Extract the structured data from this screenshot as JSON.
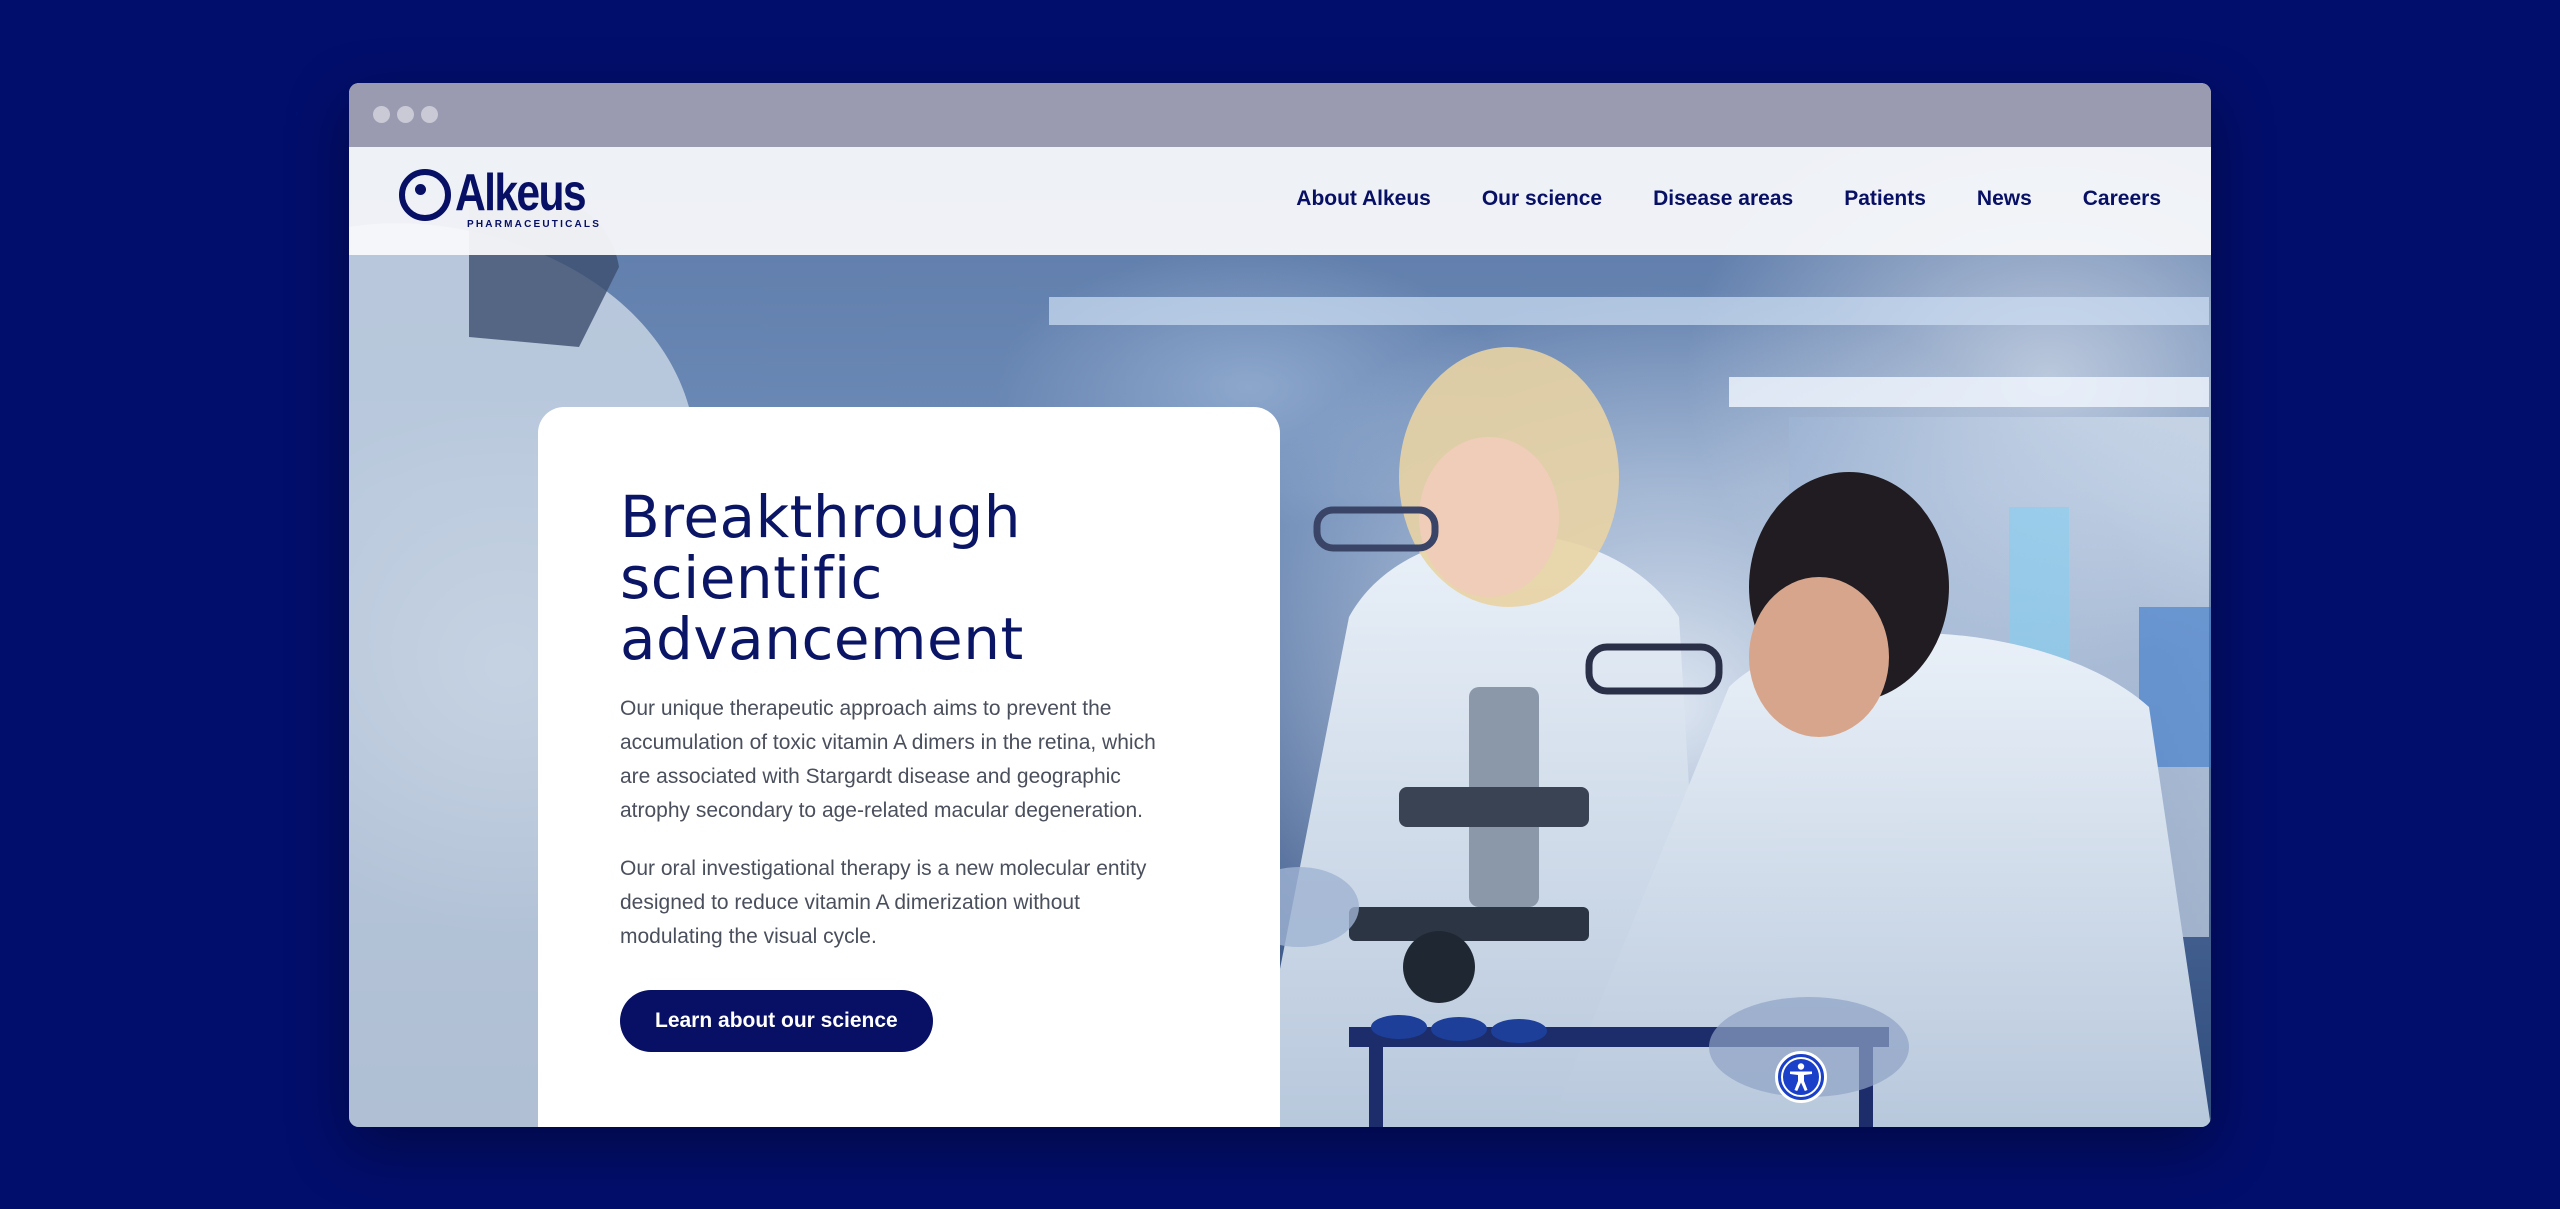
{
  "nav": {
    "logo_text": "Alkeus",
    "logo_subtext": "PHARMACEUTICALS",
    "items": [
      {
        "label": "About Alkeus"
      },
      {
        "label": "Our science"
      },
      {
        "label": "Disease areas"
      },
      {
        "label": "Patients"
      },
      {
        "label": "News"
      },
      {
        "label": "Careers"
      }
    ]
  },
  "hero": {
    "title_line1": "Breakthrough",
    "title_line2": "scientific",
    "title_line3": "advancement",
    "paragraph1": "Our unique therapeutic approach aims to prevent the accumulation of toxic vitamin A dimers in the retina, which are associated with Stargardt disease and geographic atrophy secondary to age-related macular degeneration.",
    "paragraph2": "Our oral investigational therapy is a new molecular entity designed to reduce vitamin A dimerization without modulating the visual cycle.",
    "cta_label": "Learn about our science"
  },
  "icons": {
    "accessibility": "accessibility-icon"
  },
  "colors": {
    "page_background": "#020e6b",
    "brand_navy": "#071064",
    "accessibility_blue": "#1a3fc9"
  }
}
